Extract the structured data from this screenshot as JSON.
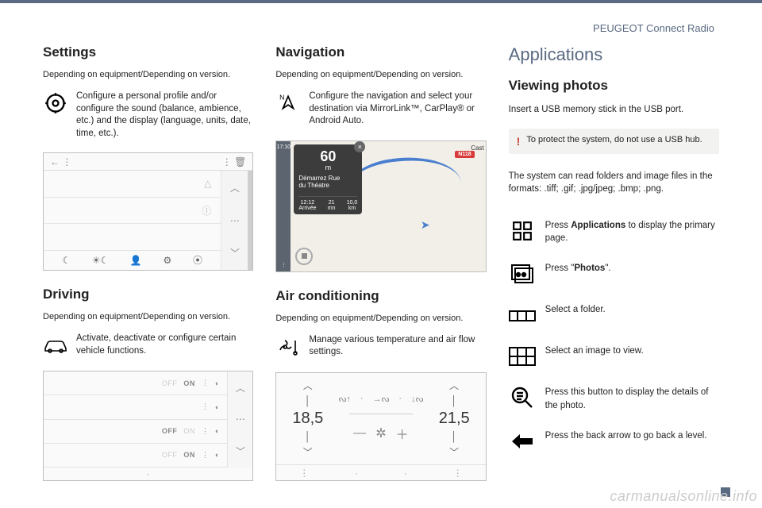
{
  "header": {
    "right": "PEUGEOT Connect Radio"
  },
  "settings": {
    "title": "Settings",
    "sub": "Depending on equipment/Depending on version.",
    "desc": "Configure a personal profile and/or configure the sound (balance, ambience, etc.) and the display (language, units, date, time, etc.)."
  },
  "driving": {
    "title": "Driving",
    "sub": "Depending on equipment/Depending on version.",
    "desc": "Activate, deactivate or configure certain vehicle functions.",
    "rows": [
      {
        "off": "OFF",
        "on": "ON"
      },
      {
        "off": "",
        "on": ""
      },
      {
        "off": "OFF",
        "on": "ON"
      },
      {
        "off": "OFF",
        "on": "ON"
      }
    ]
  },
  "navigation": {
    "title": "Navigation",
    "sub": "Depending on equipment/Depending on version.",
    "desc": "Configure the navigation and select your destination via MirrorLink™, CarPlay® or Android Auto.",
    "map": {
      "dist": "60",
      "unit": "m",
      "street1": "Démarrez Rue",
      "street2": "du Théatre",
      "eta_time_v": "12:12",
      "eta_time_l": "Arrivée",
      "eta_min_v": "21",
      "eta_min_l": "mn",
      "eta_km_v": "10,0",
      "eta_km_l": "km",
      "road_badge": "N118",
      "east": "Cast",
      "side_time": "17:10"
    }
  },
  "ac": {
    "title": "Air conditioning",
    "sub": "Depending on equipment/Depending on version.",
    "desc": "Manage various temperature and air flow settings.",
    "left_temp": "18,5",
    "right_temp": "21,5"
  },
  "apps": {
    "heading": "Applications",
    "title": "Viewing photos",
    "intro": "Insert a USB memory stick in the USB port.",
    "warn": "To protect the system, do not use a USB hub.",
    "formats": "The system can read folders and image files in the formats: .tiff; .gif; .jpg/jpeg; .bmp; .png.",
    "step1_pre": "Press ",
    "step1_bold": "Applications",
    "step1_post": " to display the primary page.",
    "step2_pre": "Press \"",
    "step2_bold": "Photos",
    "step2_post": "\".",
    "step3": "Select a folder.",
    "step4": "Select an image to view.",
    "step5": "Press this button to display the details of the photo.",
    "step6": "Press the back arrow to go back a level."
  },
  "watermark": "carmanualsonline.info"
}
